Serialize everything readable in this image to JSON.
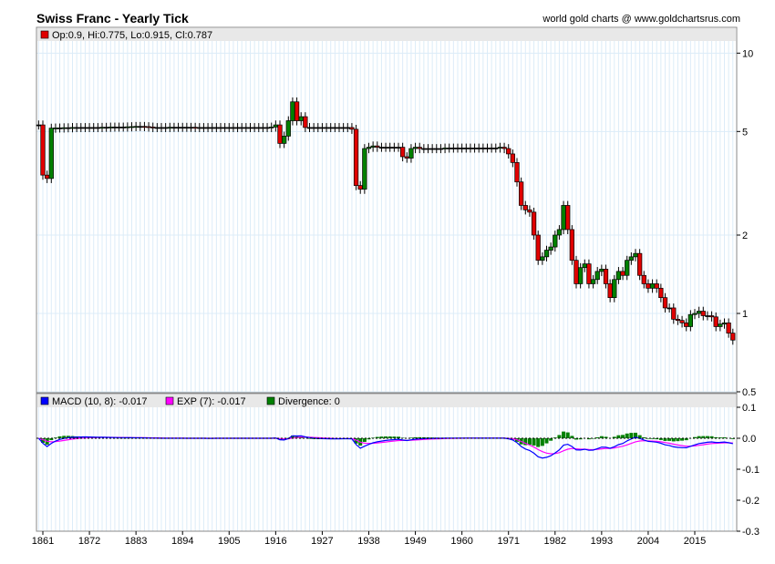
{
  "header": {
    "title": "Swiss Franc - Yearly Tick",
    "site": "world gold charts @ www.goldchartsrus.com"
  },
  "legend_price": {
    "text": "Op:0.9, Hi:0.775, Lo:0.915, Cl:0.787",
    "color": "#e00000"
  },
  "legend_macd": [
    {
      "text": "MACD (10, 8): -0.017",
      "color": "#0000ff"
    },
    {
      "text": "EXP (7): -0.017",
      "color": "#ff00ff"
    },
    {
      "text": "Divergence: 0",
      "color": "#008000"
    }
  ],
  "chart_data": [
    {
      "type": "candlestick",
      "title": "Swiss Franc - Yearly Tick",
      "scale": "log",
      "y_ticks": [
        "10",
        "5",
        "2",
        "1",
        "0.5"
      ],
      "y_values": [
        10,
        5,
        2,
        1,
        0.5
      ],
      "ylim": [
        0.5,
        11.5
      ],
      "x_ticks": [
        "1861",
        "1872",
        "1883",
        "1894",
        "1905",
        "1916",
        "1927",
        "1938",
        "1949",
        "1960",
        "1971",
        "1982",
        "1993",
        "2004",
        "2015"
      ],
      "xlim": [
        1859,
        2025
      ],
      "start_year": 1860,
      "closes": [
        5.3,
        3.4,
        3.3,
        5.15,
        5.16,
        5.16,
        5.17,
        5.17,
        5.18,
        5.18,
        5.18,
        5.18,
        5.18,
        5.18,
        5.18,
        5.19,
        5.19,
        5.2,
        5.2,
        5.2,
        5.2,
        5.21,
        5.22,
        5.23,
        5.23,
        5.22,
        5.2,
        5.18,
        5.18,
        5.18,
        5.18,
        5.19,
        5.19,
        5.19,
        5.19,
        5.19,
        5.19,
        5.18,
        5.18,
        5.18,
        5.18,
        5.18,
        5.18,
        5.18,
        5.18,
        5.18,
        5.18,
        5.18,
        5.18,
        5.18,
        5.18,
        5.18,
        5.18,
        5.18,
        5.18,
        5.2,
        5.3,
        4.5,
        4.8,
        5.5,
        6.5,
        5.5,
        5.7,
        5.18,
        5.18,
        5.18,
        5.18,
        5.18,
        5.18,
        5.18,
        5.18,
        5.18,
        5.18,
        5.18,
        5.1,
        3.1,
        3.0,
        4.3,
        4.35,
        4.4,
        4.35,
        4.35,
        4.35,
        4.35,
        4.35,
        4.35,
        4.0,
        3.95,
        4.3,
        4.35,
        4.3,
        4.3,
        4.3,
        4.3,
        4.3,
        4.3,
        4.32,
        4.32,
        4.32,
        4.32,
        4.32,
        4.32,
        4.32,
        4.32,
        4.32,
        4.32,
        4.32,
        4.32,
        4.32,
        4.35,
        4.3,
        4.1,
        3.8,
        3.2,
        2.6,
        2.5,
        2.45,
        2.0,
        1.6,
        1.65,
        1.75,
        1.8,
        2.0,
        2.1,
        2.6,
        2.1,
        1.6,
        1.3,
        1.5,
        1.55,
        1.3,
        1.35,
        1.45,
        1.48,
        1.3,
        1.15,
        1.35,
        1.45,
        1.4,
        1.6,
        1.65,
        1.7,
        1.4,
        1.3,
        1.25,
        1.3,
        1.25,
        1.15,
        1.05,
        1.05,
        0.95,
        0.94,
        0.92,
        0.89,
        0.99,
        1.0,
        1.02,
        0.98,
        0.98,
        0.97,
        0.89,
        0.91,
        0.92,
        0.84,
        0.79
      ]
    },
    {
      "type": "macd",
      "y_ticks": [
        "0.1",
        "0.0",
        "-0.1",
        "-0.2",
        "-0.3"
      ],
      "y_values": [
        0.1,
        0,
        -0.1,
        -0.2,
        -0.3
      ],
      "ylim": [
        -0.3,
        0.1
      ],
      "series": [
        {
          "name": "MACD (10, 8)",
          "color": "#0000ff"
        },
        {
          "name": "EXP (7)",
          "color": "#ff00ff"
        },
        {
          "name": "Divergence",
          "color": "#008000"
        }
      ]
    }
  ]
}
